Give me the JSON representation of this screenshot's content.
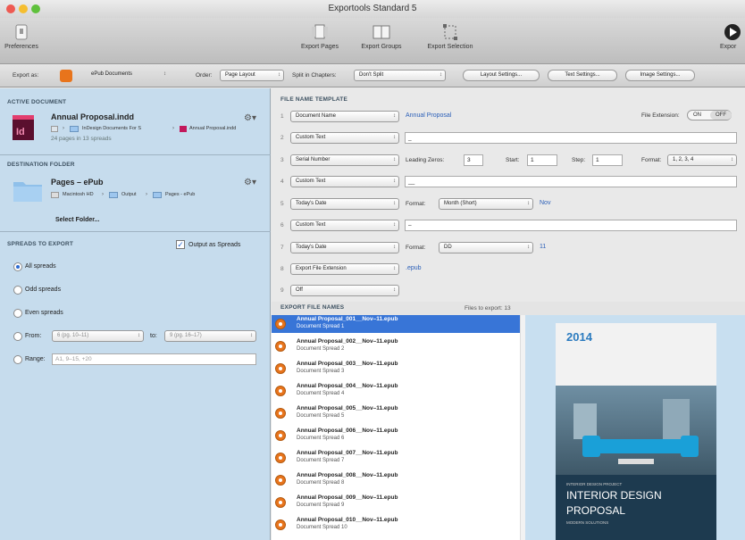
{
  "window": {
    "title": "Exportools Standard 5"
  },
  "toolbar": {
    "preferences": "Preferences",
    "export_pages": "Export Pages",
    "export_groups": "Export Groups",
    "export_selection": "Export Selection",
    "export": "Expor"
  },
  "optionsbar": {
    "export_as_label": "Export as:",
    "export_as_value": "ePub Documents",
    "order_label": "Order:",
    "order_value": "Page Layout",
    "split_label": "Split in Chapters:",
    "split_value": "Don't Split",
    "layout_settings": "Layout Settings...",
    "text_settings": "Text Settings...",
    "image_settings": "Image Settings..."
  },
  "active_document": {
    "header": "ACTIVE DOCUMENT",
    "name": "Annual Proposal.indd",
    "path": [
      "InDesign Documents For S",
      "Annual Proposal.indd"
    ],
    "pages": "24 pages in 13 spreads"
  },
  "destination": {
    "header": "DESTINATION FOLDER",
    "name": "Pages – ePub",
    "path": [
      "Macintosh HD",
      "Output",
      "Pages - ePub"
    ],
    "select": "Select Folder..."
  },
  "spreads": {
    "header": "SPREADS TO EXPORT",
    "output_as_spreads": "Output as Spreads",
    "all": "All spreads",
    "odd": "Odd spreads",
    "even": "Even spreads",
    "from_label": "From:",
    "from_value": "6 (pg. 10–11)",
    "to_label": "to:",
    "to_value": "9 (pg. 16–17)",
    "range_label": "Range:",
    "range_placeholder": "A1, 9–15, +20"
  },
  "template": {
    "header": "FILE NAME TEMPLATE",
    "file_ext_label": "File Extension:",
    "on": "ON",
    "off": "OFF",
    "rows": [
      {
        "n": "1",
        "value": "Document Name",
        "text": "Annual Proposal"
      },
      {
        "n": "2",
        "value": "Custom Text",
        "text": "_"
      },
      {
        "n": "3",
        "value": "Serial Number",
        "zeros_label": "Leading Zeros:",
        "zeros": "3",
        "start_label": "Start:",
        "start": "1",
        "step_label": "Step:",
        "step": "1",
        "format_label": "Format:",
        "format": "1, 2, 3, 4"
      },
      {
        "n": "4",
        "value": "Custom Text",
        "text": "__"
      },
      {
        "n": "5",
        "value": "Today's Date",
        "format_label": "Format:",
        "format": "Month (Short)",
        "text": "Nov"
      },
      {
        "n": "6",
        "value": "Custom Text",
        "text": "–"
      },
      {
        "n": "7",
        "value": "Today's Date",
        "format_label": "Format:",
        "format": "DD",
        "text": "11"
      },
      {
        "n": "8",
        "value": "Export File Extension",
        "text": ".epub"
      },
      {
        "n": "9",
        "value": "Off"
      }
    ]
  },
  "export_list": {
    "header": "EXPORT FILE NAMES",
    "count": "Files to export: 13",
    "items": [
      {
        "name": "Annual Proposal_001__Nov–11.epub",
        "sub": "Document Spread 1"
      },
      {
        "name": "Annual Proposal_002__Nov–11.epub",
        "sub": "Document Spread 2"
      },
      {
        "name": "Annual Proposal_003__Nov–11.epub",
        "sub": "Document Spread 3"
      },
      {
        "name": "Annual Proposal_004__Nov–11.epub",
        "sub": "Document Spread 4"
      },
      {
        "name": "Annual Proposal_005__Nov–11.epub",
        "sub": "Document Spread 5"
      },
      {
        "name": "Annual Proposal_006__Nov–11.epub",
        "sub": "Document Spread 6"
      },
      {
        "name": "Annual Proposal_007__Nov–11.epub",
        "sub": "Document Spread 7"
      },
      {
        "name": "Annual Proposal_008__Nov–11.epub",
        "sub": "Document Spread 8"
      },
      {
        "name": "Annual Proposal_009__Nov–11.epub",
        "sub": "Document Spread 9"
      },
      {
        "name": "Annual Proposal_010__Nov–11.epub",
        "sub": "Document Spread 10"
      }
    ]
  },
  "preview": {
    "year": "2014",
    "small": "INTERIOR DESIGN PROJECT",
    "title1": "INTERIOR DESIGN",
    "title2": "PROPOSAL",
    "tag": "MODERN SOLUTIONS"
  },
  "colors": {
    "selection": "#3875d7",
    "accent_orange": "#e8741c",
    "sidebar": "#c6dced"
  }
}
